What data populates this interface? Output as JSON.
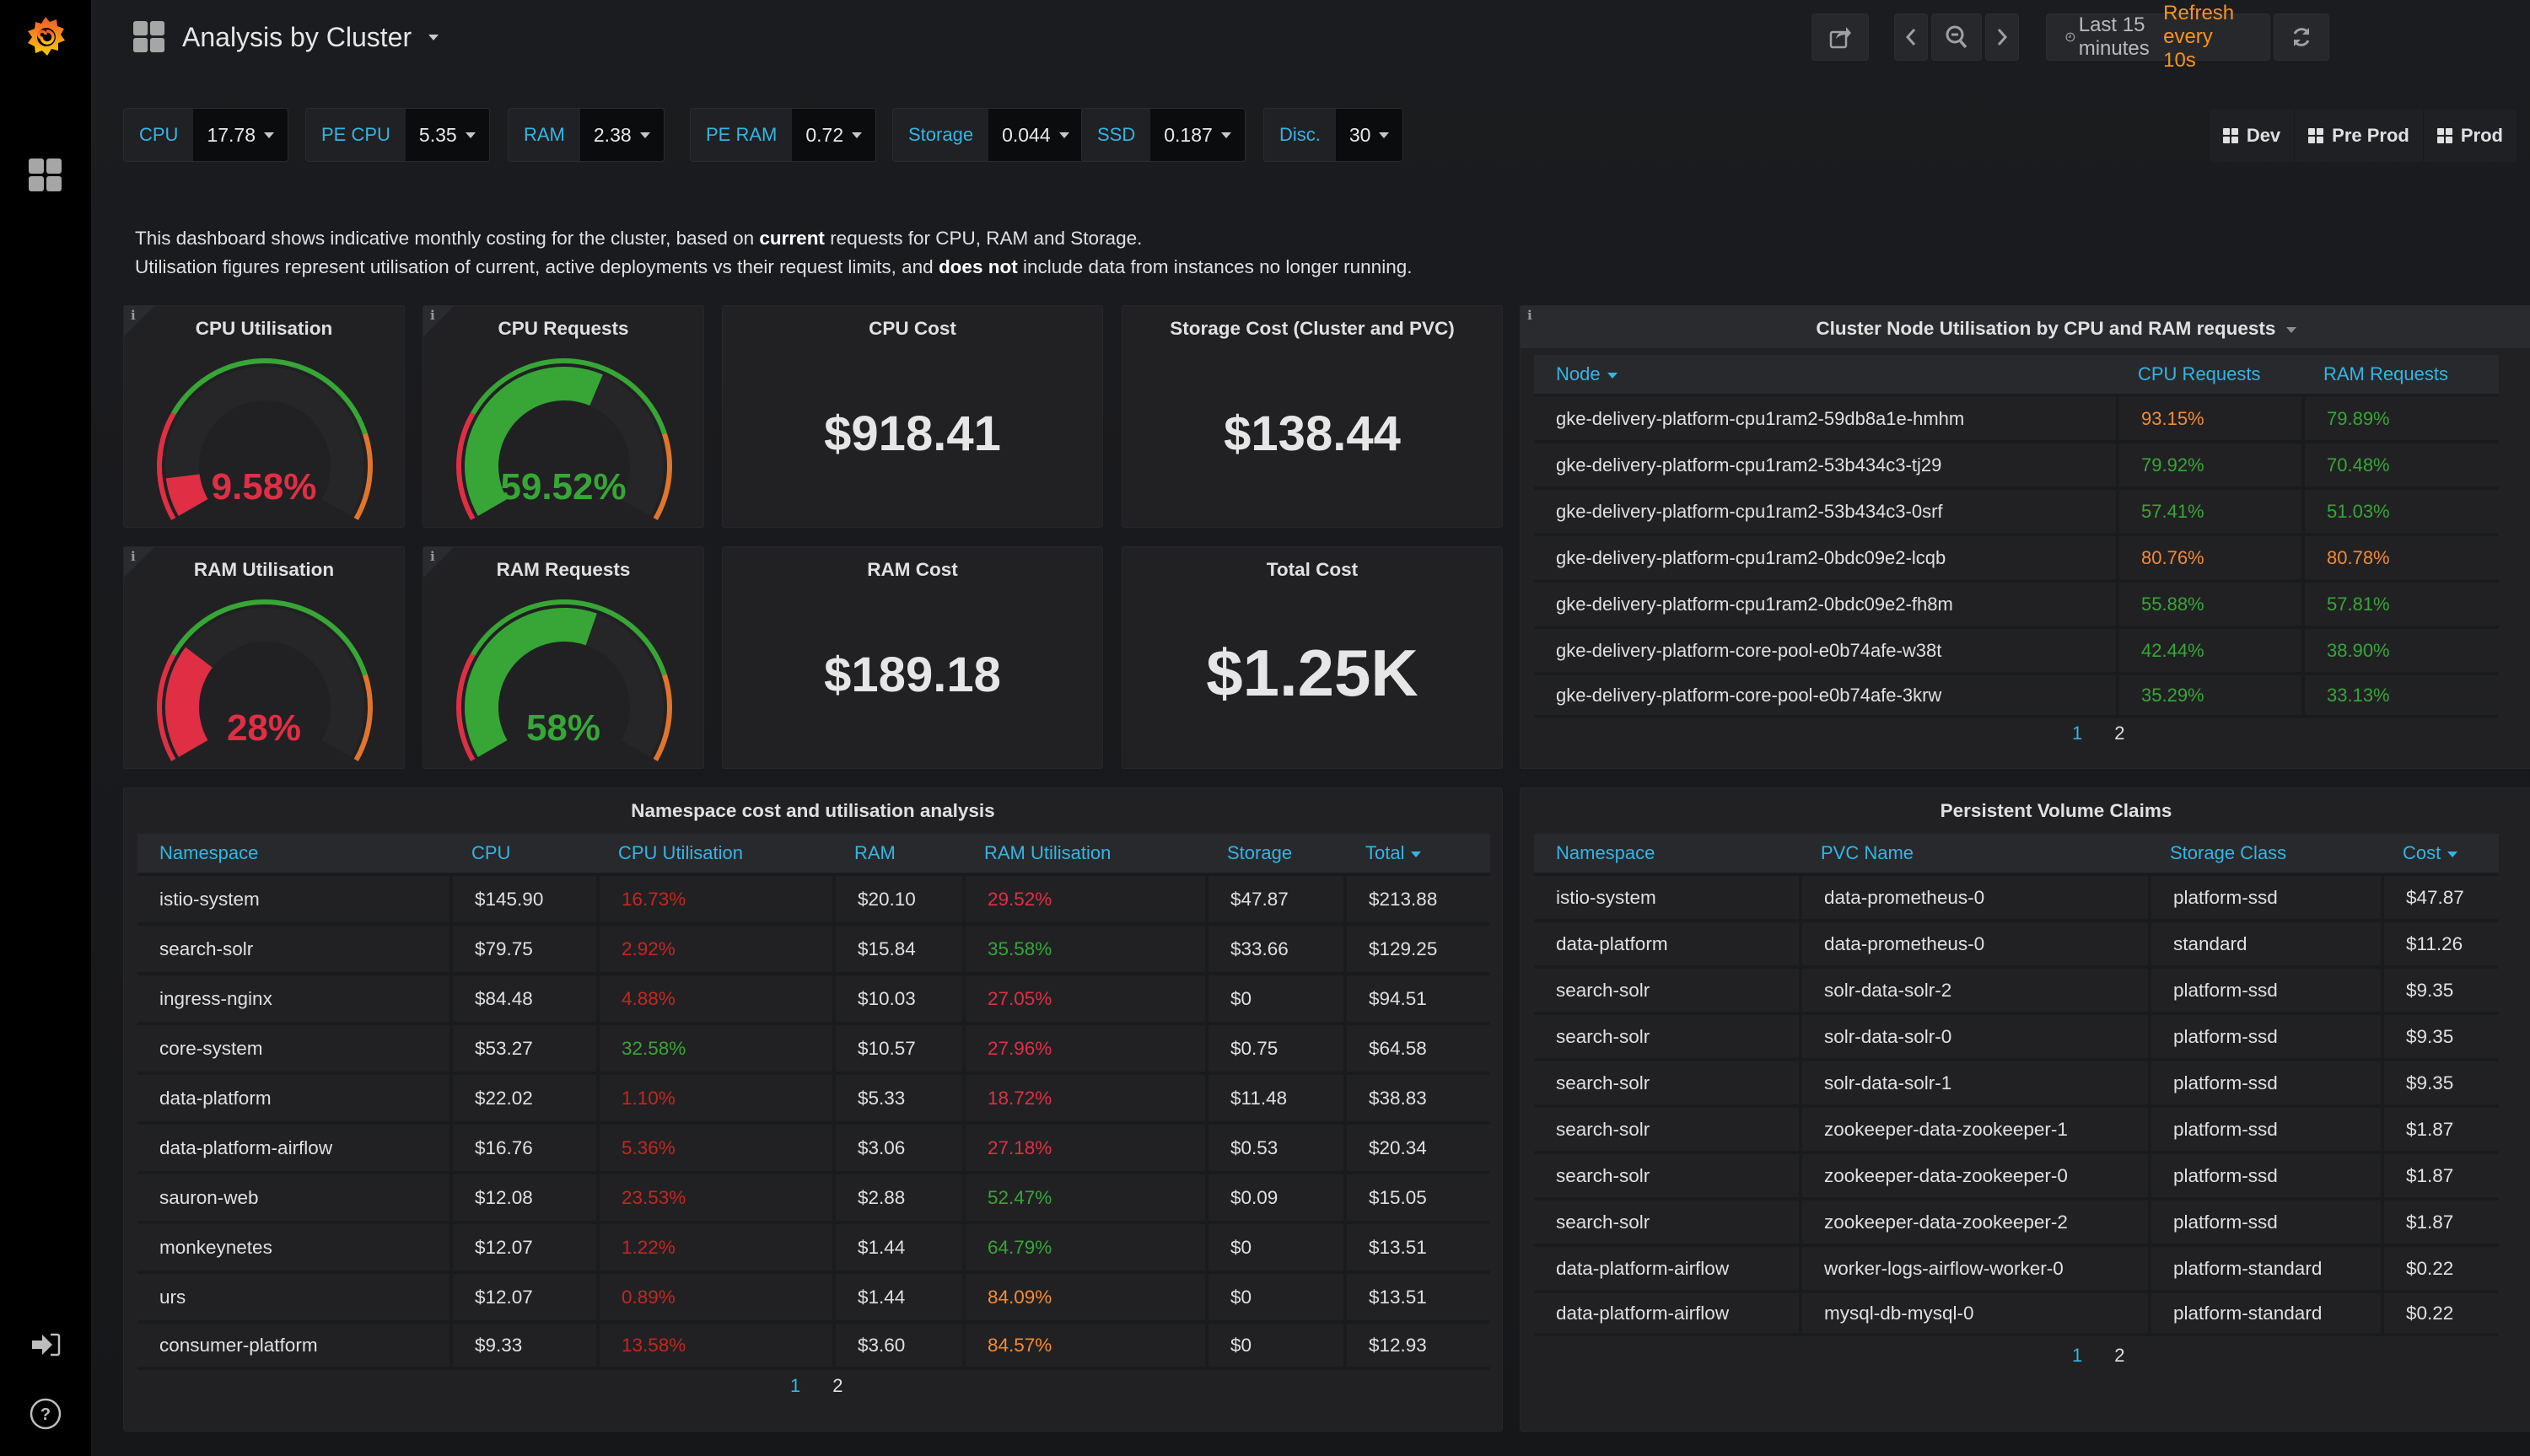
{
  "colors": {
    "accent": "#33b5e5",
    "red": "#e02f44",
    "dark_red": "#c4271f",
    "green": "#37a636",
    "orange": "#f28b34",
    "refresh": "#f7941e"
  },
  "sidebar": {
    "logo": "grafana-logo-icon",
    "items": [
      {
        "name": "dashboards",
        "icon": "grid-icon"
      },
      {
        "name": "sign-in",
        "icon": "sign-in-icon"
      },
      {
        "name": "help",
        "icon": "help-icon"
      }
    ]
  },
  "header": {
    "title": "Analysis by Cluster",
    "time_range": "Last 15 minutes",
    "refresh": "Refresh every 10s"
  },
  "variables": [
    {
      "label": "CPU",
      "value": "17.78"
    },
    {
      "label": "PE CPU",
      "value": "5.35"
    },
    {
      "label": "RAM",
      "value": "2.38"
    },
    {
      "label": "PE RAM",
      "value": "0.72"
    },
    {
      "label": "Storage",
      "value": "0.044"
    },
    {
      "label": "SSD",
      "value": "0.187"
    },
    {
      "label": "Disc.",
      "value": "30"
    }
  ],
  "links": [
    {
      "label": "Dev"
    },
    {
      "label": "Pre Prod"
    },
    {
      "label": "Prod"
    }
  ],
  "description": {
    "line1_a": "This dashboard shows indicative monthly costing for the cluster, based on ",
    "line1_b": "current",
    "line1_c": " requests for CPU, RAM and Storage.",
    "line2_a": "Utilisation figures represent utilisation of current, active deployments vs their request limits, and ",
    "line2_b": "does not",
    "line2_c": " include data from instances no longer running."
  },
  "gauges": [
    {
      "title": "CPU Utilisation",
      "value_text": "9.58%",
      "value": 9.58,
      "color": "#e02f44"
    },
    {
      "title": "CPU Requests",
      "value_text": "59.52%",
      "value": 59.52,
      "color": "#37a636"
    },
    {
      "title": "RAM Utilisation",
      "value_text": "28%",
      "value": 28,
      "color": "#e02f44"
    },
    {
      "title": "RAM Requests",
      "value_text": "58%",
      "value": 58,
      "color": "#37a636"
    }
  ],
  "gauge_thresholds": {
    "min": 0,
    "max": 100,
    "red_to": 25,
    "green_to": 80
  },
  "stats": [
    {
      "title": "CPU Cost",
      "value": "$918.41"
    },
    {
      "title": "Storage Cost (Cluster and PVC)",
      "value": "$138.44"
    },
    {
      "title": "RAM Cost",
      "value": "$189.18"
    },
    {
      "title": "Total Cost",
      "value": "$1.25K"
    }
  ],
  "node_table": {
    "title": "Cluster Node Utilisation by CPU and RAM requests",
    "columns": [
      "Node",
      "CPU Requests",
      "RAM Requests"
    ],
    "rows": [
      {
        "node": "gke-delivery-platform-cpu1ram2-59db8a1e-hmhm",
        "cpu": "93.15%",
        "cpu_color": "#f28b34",
        "ram": "79.89%",
        "ram_color": "#37a636"
      },
      {
        "node": "gke-delivery-platform-cpu1ram2-53b434c3-tj29",
        "cpu": "79.92%",
        "cpu_color": "#37a636",
        "ram": "70.48%",
        "ram_color": "#37a636"
      },
      {
        "node": "gke-delivery-platform-cpu1ram2-53b434c3-0srf",
        "cpu": "57.41%",
        "cpu_color": "#37a636",
        "ram": "51.03%",
        "ram_color": "#37a636"
      },
      {
        "node": "gke-delivery-platform-cpu1ram2-0bdc09e2-lcqb",
        "cpu": "80.76%",
        "cpu_color": "#f28b34",
        "ram": "80.78%",
        "ram_color": "#f28b34"
      },
      {
        "node": "gke-delivery-platform-cpu1ram2-0bdc09e2-fh8m",
        "cpu": "55.88%",
        "cpu_color": "#37a636",
        "ram": "57.81%",
        "ram_color": "#37a636"
      },
      {
        "node": "gke-delivery-platform-core-pool-e0b74afe-w38t",
        "cpu": "42.44%",
        "cpu_color": "#37a636",
        "ram": "38.90%",
        "ram_color": "#37a636"
      },
      {
        "node": "gke-delivery-platform-core-pool-e0b74afe-3krw",
        "cpu": "35.29%",
        "cpu_color": "#37a636",
        "ram": "33.13%",
        "ram_color": "#37a636"
      }
    ],
    "pages": [
      "1",
      "2"
    ],
    "active_page": "1"
  },
  "namespace_table": {
    "title": "Namespace cost and utilisation analysis",
    "columns": [
      "Namespace",
      "CPU",
      "CPU Utilisation",
      "RAM",
      "RAM Utilisation",
      "Storage",
      "Total"
    ],
    "rows": [
      {
        "ns": "istio-system",
        "cpu": "$145.90",
        "cpu_util": "16.73%",
        "cpu_util_color": "#c4271f",
        "ram": "$20.10",
        "ram_util": "29.52%",
        "ram_util_color": "#e02f44",
        "storage": "$47.87",
        "total": "$213.88"
      },
      {
        "ns": "search-solr",
        "cpu": "$79.75",
        "cpu_util": "2.92%",
        "cpu_util_color": "#c4271f",
        "ram": "$15.84",
        "ram_util": "35.58%",
        "ram_util_color": "#37a636",
        "storage": "$33.66",
        "total": "$129.25"
      },
      {
        "ns": "ingress-nginx",
        "cpu": "$84.48",
        "cpu_util": "4.88%",
        "cpu_util_color": "#c4271f",
        "ram": "$10.03",
        "ram_util": "27.05%",
        "ram_util_color": "#e02f44",
        "storage": "$0",
        "total": "$94.51"
      },
      {
        "ns": "core-system",
        "cpu": "$53.27",
        "cpu_util": "32.58%",
        "cpu_util_color": "#37a636",
        "ram": "$10.57",
        "ram_util": "27.96%",
        "ram_util_color": "#e02f44",
        "storage": "$0.75",
        "total": "$64.58"
      },
      {
        "ns": "data-platform",
        "cpu": "$22.02",
        "cpu_util": "1.10%",
        "cpu_util_color": "#c4271f",
        "ram": "$5.33",
        "ram_util": "18.72%",
        "ram_util_color": "#e02f44",
        "storage": "$11.48",
        "total": "$38.83"
      },
      {
        "ns": "data-platform-airflow",
        "cpu": "$16.76",
        "cpu_util": "5.36%",
        "cpu_util_color": "#c4271f",
        "ram": "$3.06",
        "ram_util": "27.18%",
        "ram_util_color": "#e02f44",
        "storage": "$0.53",
        "total": "$20.34"
      },
      {
        "ns": "sauron-web",
        "cpu": "$12.08",
        "cpu_util": "23.53%",
        "cpu_util_color": "#c4271f",
        "ram": "$2.88",
        "ram_util": "52.47%",
        "ram_util_color": "#37a636",
        "storage": "$0.09",
        "total": "$15.05"
      },
      {
        "ns": "monkeynetes",
        "cpu": "$12.07",
        "cpu_util": "1.22%",
        "cpu_util_color": "#c4271f",
        "ram": "$1.44",
        "ram_util": "64.79%",
        "ram_util_color": "#37a636",
        "storage": "$0",
        "total": "$13.51"
      },
      {
        "ns": "urs",
        "cpu": "$12.07",
        "cpu_util": "0.89%",
        "cpu_util_color": "#c4271f",
        "ram": "$1.44",
        "ram_util": "84.09%",
        "ram_util_color": "#f28b34",
        "storage": "$0",
        "total": "$13.51"
      },
      {
        "ns": "consumer-platform",
        "cpu": "$9.33",
        "cpu_util": "13.58%",
        "cpu_util_color": "#c4271f",
        "ram": "$3.60",
        "ram_util": "84.57%",
        "ram_util_color": "#f28b34",
        "storage": "$0",
        "total": "$12.93"
      }
    ],
    "pages": [
      "1",
      "2"
    ],
    "active_page": "1"
  },
  "pvc_table": {
    "title": "Persistent Volume Claims",
    "columns": [
      "Namespace",
      "PVC Name",
      "Storage Class",
      "Cost"
    ],
    "rows": [
      {
        "ns": "istio-system",
        "pvc": "data-prometheus-0",
        "class": "platform-ssd",
        "cost": "$47.87"
      },
      {
        "ns": "data-platform",
        "pvc": "data-prometheus-0",
        "class": "standard",
        "cost": "$11.26"
      },
      {
        "ns": "search-solr",
        "pvc": "solr-data-solr-2",
        "class": "platform-ssd",
        "cost": "$9.35"
      },
      {
        "ns": "search-solr",
        "pvc": "solr-data-solr-0",
        "class": "platform-ssd",
        "cost": "$9.35"
      },
      {
        "ns": "search-solr",
        "pvc": "solr-data-solr-1",
        "class": "platform-ssd",
        "cost": "$9.35"
      },
      {
        "ns": "search-solr",
        "pvc": "zookeeper-data-zookeeper-1",
        "class": "platform-ssd",
        "cost": "$1.87"
      },
      {
        "ns": "search-solr",
        "pvc": "zookeeper-data-zookeeper-0",
        "class": "platform-ssd",
        "cost": "$1.87"
      },
      {
        "ns": "search-solr",
        "pvc": "zookeeper-data-zookeeper-2",
        "class": "platform-ssd",
        "cost": "$1.87"
      },
      {
        "ns": "data-platform-airflow",
        "pvc": "worker-logs-airflow-worker-0",
        "class": "platform-standard",
        "cost": "$0.22"
      },
      {
        "ns": "data-platform-airflow",
        "pvc": "mysql-db-mysql-0",
        "class": "platform-standard",
        "cost": "$0.22"
      }
    ],
    "pages": [
      "1",
      "2"
    ],
    "active_page": "1"
  }
}
